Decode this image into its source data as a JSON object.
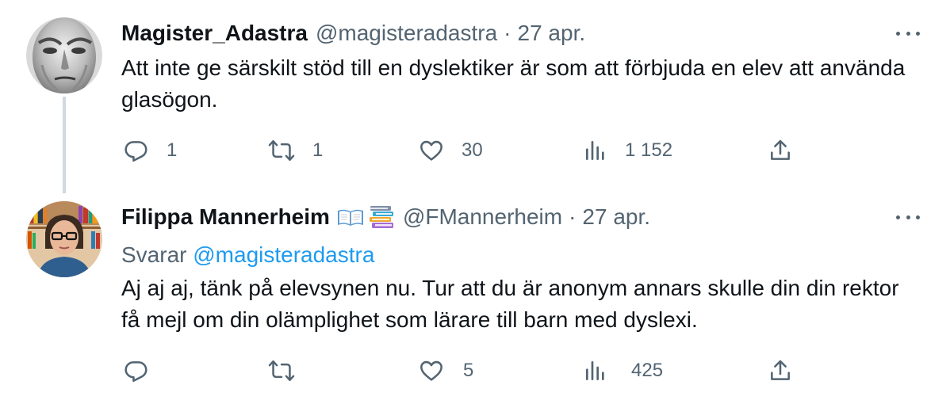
{
  "tweets": [
    {
      "display_name": "Magister_Adastra",
      "handle": "@magisteradastra",
      "separator": "·",
      "date": "27 apr.",
      "text": "Att inte ge särskilt stöd till en dyslektiker är som att förbjuda en elev att använda glasögon.",
      "avatar_icon": "statue-face-avatar",
      "stats": {
        "replies": "1",
        "retweets": "1",
        "likes": "30",
        "views": "1 152"
      }
    },
    {
      "display_name": "Filippa Mannerheim",
      "name_emoji": [
        "open-book-emoji",
        "books-emoji"
      ],
      "handle": "@FMannerheim",
      "separator": "·",
      "date": "27 apr.",
      "replying_prefix": "Svarar",
      "replying_to": "@magisteradastra",
      "text": "Aj aj aj, tänk på elevsynen nu. Tur att du är anonym annars skulle din din rektor få mejl om din olämplighet som lärare till barn med dyslexi.",
      "avatar_icon": "woman-glasses-bookshelf-avatar",
      "stats": {
        "replies": "",
        "retweets": "",
        "likes": "5",
        "views": "425"
      }
    }
  ],
  "colors": {
    "text": "#0f1419",
    "secondary": "#536471",
    "link": "#1d9bf0",
    "thread_line": "#cfd9de",
    "background": "#ffffff"
  },
  "icons": [
    "reply-icon",
    "retweet-icon",
    "like-icon",
    "views-icon",
    "share-icon",
    "more-icon"
  ]
}
